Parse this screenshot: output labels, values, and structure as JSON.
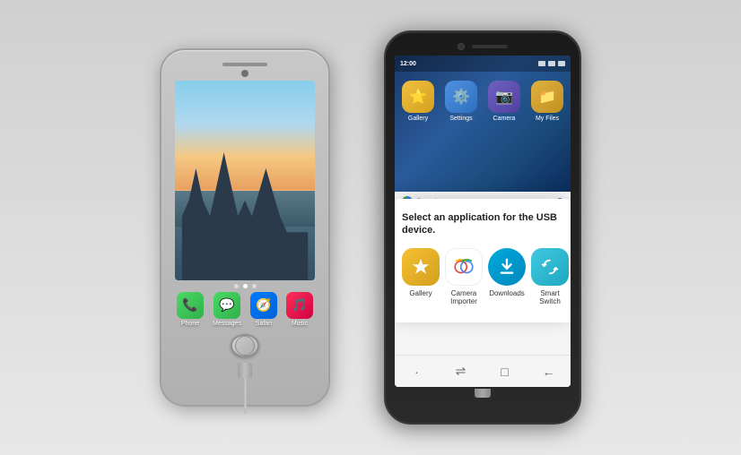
{
  "scene": {
    "background": "#e0e0e0"
  },
  "iphone": {
    "icons": [
      {
        "id": "phone",
        "label": "Phone",
        "bg": "icon-phone",
        "emoji": "📞"
      },
      {
        "id": "messages",
        "label": "Messages",
        "bg": "icon-messages",
        "emoji": "💬"
      },
      {
        "id": "safari",
        "label": "Safari",
        "bg": "icon-safari",
        "emoji": "🧭"
      },
      {
        "id": "music",
        "label": "Music",
        "bg": "icon-music",
        "emoji": "🎵"
      }
    ]
  },
  "samsung": {
    "time": "12:00",
    "top_apps": [
      {
        "id": "gallery",
        "label": "Gallery",
        "class": "s-gallery",
        "emoji": "⭐"
      },
      {
        "id": "settings",
        "label": "Settings",
        "class": "s-settings",
        "emoji": "⚙️"
      },
      {
        "id": "camera",
        "label": "Camera",
        "class": "s-camera",
        "emoji": "📷"
      },
      {
        "id": "myfiles",
        "label": "My Files",
        "class": "s-myfiles",
        "emoji": "📁"
      }
    ]
  },
  "dialog": {
    "title": "Select an application for the USB device.",
    "apps": [
      {
        "id": "gallery",
        "label": "Gallery",
        "class": "d-gallery"
      },
      {
        "id": "camera-importer",
        "label": "Camera\nImporter",
        "class": "d-camera"
      },
      {
        "id": "downloads",
        "label": "Downloads",
        "class": "d-downloads"
      },
      {
        "id": "smart-switch",
        "label": "Smart Switch",
        "class": "d-smartswitch"
      }
    ]
  },
  "nav": {
    "items": [
      "·",
      "⇌",
      "□",
      "←"
    ]
  }
}
